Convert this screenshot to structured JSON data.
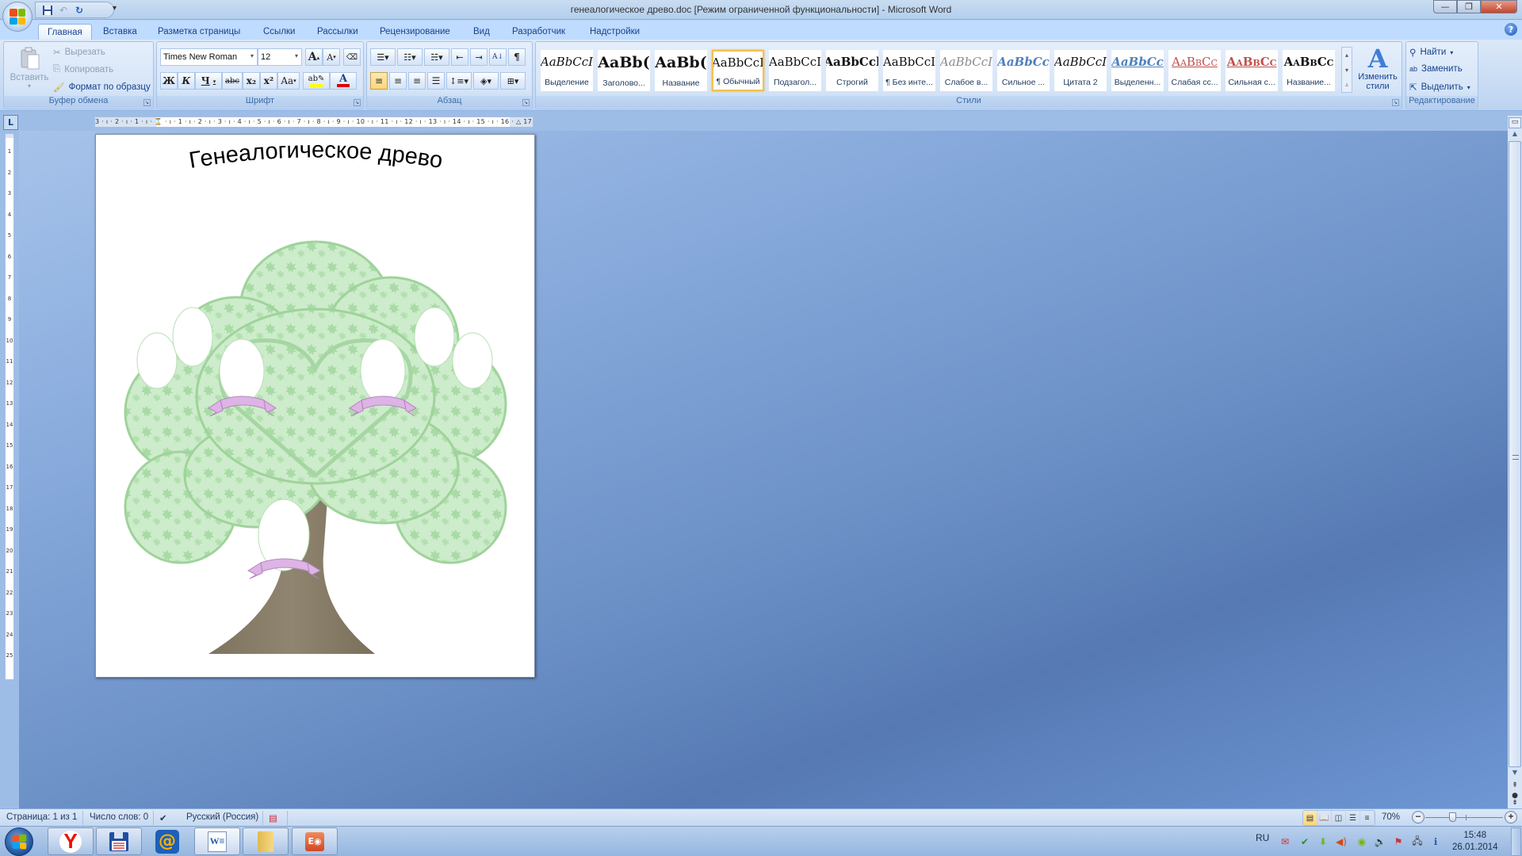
{
  "window": {
    "title": "генеалогическое древо.doc [Режим ограниченной функциональности] - Microsoft Word"
  },
  "quick_access": {
    "items": [
      {
        "name": "save",
        "icon": "save-icon"
      },
      {
        "name": "undo",
        "icon": "undo-icon"
      },
      {
        "name": "redo",
        "icon": "redo-icon"
      }
    ],
    "customize_icon": "customize-dropdown-icon"
  },
  "tabs": [
    {
      "label": "Главная",
      "active": true
    },
    {
      "label": "Вставка"
    },
    {
      "label": "Разметка страницы"
    },
    {
      "label": "Ссылки"
    },
    {
      "label": "Рассылки"
    },
    {
      "label": "Рецензирование"
    },
    {
      "label": "Вид"
    },
    {
      "label": "Разработчик"
    },
    {
      "label": "Надстройки"
    }
  ],
  "ribbon": {
    "clipboard": {
      "label": "Буфер обмена",
      "paste": "Вставить",
      "cut": "Вырезать",
      "copy": "Копировать",
      "format_painter": "Формат по образцу"
    },
    "font": {
      "label": "Шрифт",
      "font_name": "Times New Roman",
      "font_size": "12",
      "grow": "A",
      "shrink": "A",
      "bold": "Ж",
      "italic": "К",
      "underline": "Ч",
      "strike": "abc",
      "subscript": "x₂",
      "superscript": "x²",
      "case": "Aa",
      "highlight_color": "#ffff00",
      "font_color": "#e00000"
    },
    "paragraph": {
      "label": "Абзац",
      "show_marks": "¶"
    },
    "styles": {
      "label": "Стили",
      "items": [
        {
          "preview": "AaBbCcI",
          "name": "Выделение"
        },
        {
          "preview": "AaBb(",
          "name": "Заголово..."
        },
        {
          "preview": "AaBb(",
          "name": "Название"
        },
        {
          "preview": "AaBbCcI",
          "name": "¶ Обычный",
          "selected": true
        },
        {
          "preview": "AaBbCcI",
          "name": "Подзагол..."
        },
        {
          "preview": "AaBbCcl",
          "name": "Строгий"
        },
        {
          "preview": "AaBbCcI",
          "name": "¶ Без инте..."
        },
        {
          "preview": "AaBbCcI",
          "name": "Слабое в..."
        },
        {
          "preview": "AaBbCc",
          "name": "Сильное ..."
        },
        {
          "preview": "AaBbCcI",
          "name": "Цитата 2"
        },
        {
          "preview": "AaBbCc",
          "name": "Выделенн..."
        },
        {
          "preview": "AaBbCc",
          "name": "Слабая сс..."
        },
        {
          "preview": "AaBbCc",
          "name": "Сильная с..."
        },
        {
          "preview": "AaBbCc",
          "name": "Название..."
        }
      ],
      "change_styles": "Изменить стили"
    },
    "editing": {
      "label": "Редактирование",
      "find": "Найти",
      "replace": "Заменить",
      "select": "Выделить"
    }
  },
  "ruler": {
    "horizontal": "3 · ı · 2 · ı · 1 · ı · ⌛ · ı · 1 · ı · 2 · ı · 3 · ı · 4 · ı · 5 · ı · 6 · ı · 7 · ı · 8 · ı · 9 · ı · 10 · ı · 11 · ı · 12 · ı · 13 · ı · 14 · ı · 15 · ı · 16 · △ 17 · ı ·",
    "vertical_numbers": [
      "1",
      "2",
      "3",
      "4",
      "5",
      "6",
      "7",
      "8",
      "9",
      "10",
      "11",
      "12",
      "13",
      "14",
      "15",
      "16",
      "17",
      "18",
      "19",
      "20",
      "21",
      "22",
      "23",
      "24",
      "25"
    ]
  },
  "document": {
    "title": "Генеалогическое древо",
    "image": "family-tree-illustration"
  },
  "statusbar": {
    "page": "Страница: 1 из 1",
    "words": "Число слов: 0",
    "language": "Русский (Россия)",
    "zoom": "70%",
    "zoom_level": 0.7
  },
  "taskbar": {
    "apps": [
      {
        "name": "yandex-browser"
      },
      {
        "name": "floppy-save-app"
      },
      {
        "name": "mail-agent"
      },
      {
        "name": "microsoft-word",
        "active": true
      },
      {
        "name": "file-explorer"
      },
      {
        "name": "powerpoint"
      }
    ],
    "lang": "RU",
    "time": "15:48",
    "date": "26.01.2014"
  }
}
